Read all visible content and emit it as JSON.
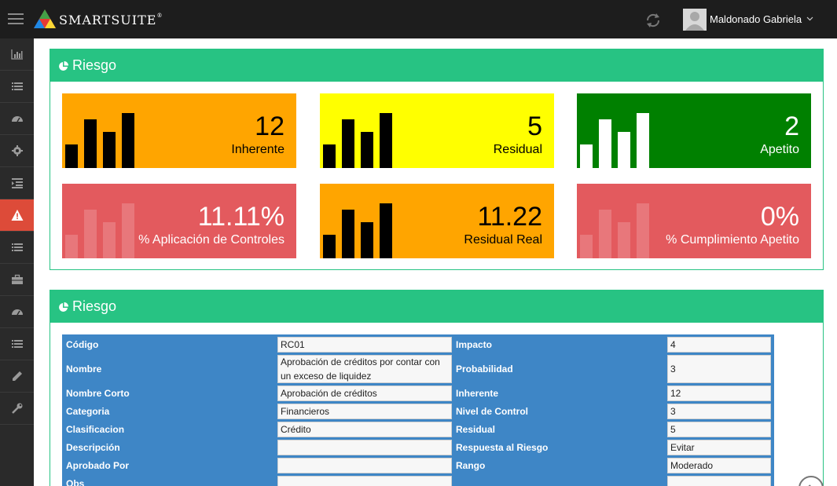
{
  "header": {
    "brand": "SmartSuite",
    "brand_mark": "®",
    "user_name": "Maldonado Gabriela",
    "icons": [
      "hamburger-icon",
      "sync-icon",
      "avatar",
      "chevron-down-icon"
    ]
  },
  "sidebar": {
    "items": [
      {
        "name": "bar-chart-icon"
      },
      {
        "name": "list-icon"
      },
      {
        "name": "dashboard-icon"
      },
      {
        "name": "gear-icon"
      },
      {
        "name": "indent-icon"
      },
      {
        "name": "warning-icon",
        "active": true
      },
      {
        "name": "list-icon"
      },
      {
        "name": "briefcase-icon"
      },
      {
        "name": "dashboard-icon"
      },
      {
        "name": "list-icon"
      },
      {
        "name": "pencil-icon"
      },
      {
        "name": "wrench-icon"
      }
    ]
  },
  "panel_kpis": {
    "title": "Riesgo",
    "tiles": [
      {
        "value": "12",
        "label": "Inherente",
        "bg": "#ffa500",
        "fg": "#000000"
      },
      {
        "value": "5",
        "label": "Residual",
        "bg": "#ffff00",
        "fg": "#000000"
      },
      {
        "value": "2",
        "label": "Apetito",
        "bg": "#008000",
        "fg": "#ffffff"
      },
      {
        "value": "11.11%",
        "label": "% Aplicación de Controles",
        "bg": "#e35a5e",
        "fg": "#ffffff"
      },
      {
        "value": "11.22",
        "label": "Residual Real",
        "bg": "#ffa500",
        "fg": "#000000"
      },
      {
        "value": "0%",
        "label": "% Cumplimiento Apetito",
        "bg": "#e35a5e",
        "fg": "#ffffff"
      }
    ]
  },
  "panel_details": {
    "title": "Riesgo",
    "rows": [
      {
        "l1": "Código",
        "v1": "RC01",
        "l2": "Impacto",
        "v2": "4"
      },
      {
        "l1": "Nombre",
        "v1": "Aprobación de créditos por contar con un exceso de liquidez",
        "l2": "Probabilidad",
        "v2": "3"
      },
      {
        "l1": "Nombre Corto",
        "v1": "Aprobación de créditos",
        "l2": "Inherente",
        "v2": "12"
      },
      {
        "l1": "Categoria",
        "v1": "Financieros",
        "l2": "Nivel de Control",
        "v2": "3"
      },
      {
        "l1": "Clasificacion",
        "v1": "Crédito",
        "l2": "Residual",
        "v2": "5"
      },
      {
        "l1": "Descripción",
        "v1": "",
        "l2": "Respuesta al Riesgo",
        "v2": "Evitar"
      },
      {
        "l1": "Aprobado Por",
        "v1": "",
        "l2": "Rango",
        "v2": "Moderado"
      },
      {
        "l1": "Obs",
        "v1": "",
        "l2": "",
        "v2": ""
      }
    ]
  },
  "colors": {
    "topbar": "#1d1d1d",
    "sidebar": "#2a2a2a",
    "accent_green": "#27c383",
    "table_blue": "#3e86c6",
    "active_red": "#dd4b39"
  }
}
